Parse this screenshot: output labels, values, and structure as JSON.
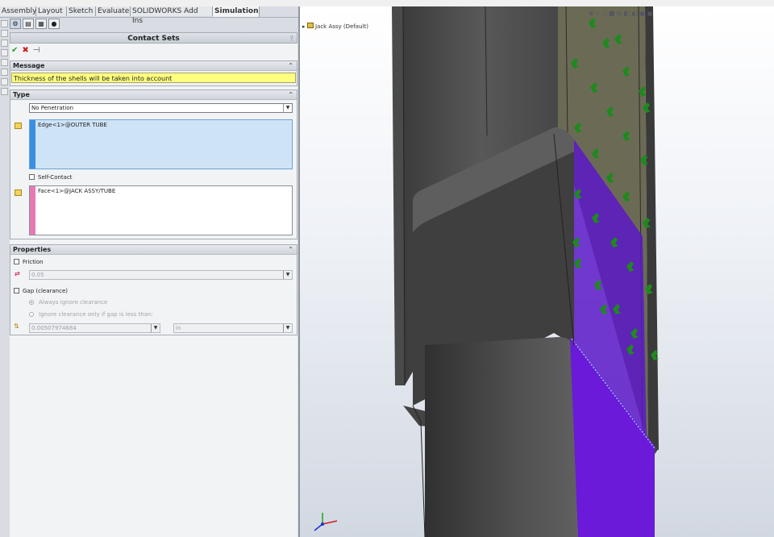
{
  "tabs": [
    {
      "label": "Assembly"
    },
    {
      "label": "Layout"
    },
    {
      "label": "Sketch"
    },
    {
      "label": "Evaluate"
    },
    {
      "label": "SOLIDWORKS Add Ins"
    },
    {
      "label": "Simulation"
    }
  ],
  "active_tab": "Simulation",
  "panel": {
    "title": "Contact Sets",
    "help": "?",
    "actions": {
      "ok": "✔",
      "cancel": "✖",
      "pin": "⊣"
    }
  },
  "message": {
    "header": "Message",
    "text": "Thickness of the shells will be taken into account"
  },
  "type_section": {
    "header": "Type",
    "contact_type": "No Penetration",
    "set1_entry": "Edge<1>@OUTER TUBE",
    "self_contact_label": "Self-Contact",
    "self_contact_checked": false,
    "set2_entry": "Face<1>@JACK ASSY/TUBE"
  },
  "properties": {
    "header": "Properties",
    "friction_label": "Friction",
    "friction_checked": false,
    "friction_value": "0.05",
    "gap_label": "Gap (clearance)",
    "gap_checked": false,
    "radio_always": "Always ignore clearance",
    "radio_conditional": "Ignore clearance only if gap is less than:",
    "gap_value": "0.00507974684",
    "gap_unit": "in"
  },
  "viewport": {
    "tree_item": "Jack Assy  (Default)",
    "colors": {
      "tube_dark": "#4a4a4a",
      "contact_face": "#6a1ad8",
      "fixture_arrow": "#1e8a1e",
      "triad_x": "#d02020",
      "triad_y": "#20a020",
      "triad_z": "#2030d0"
    }
  }
}
